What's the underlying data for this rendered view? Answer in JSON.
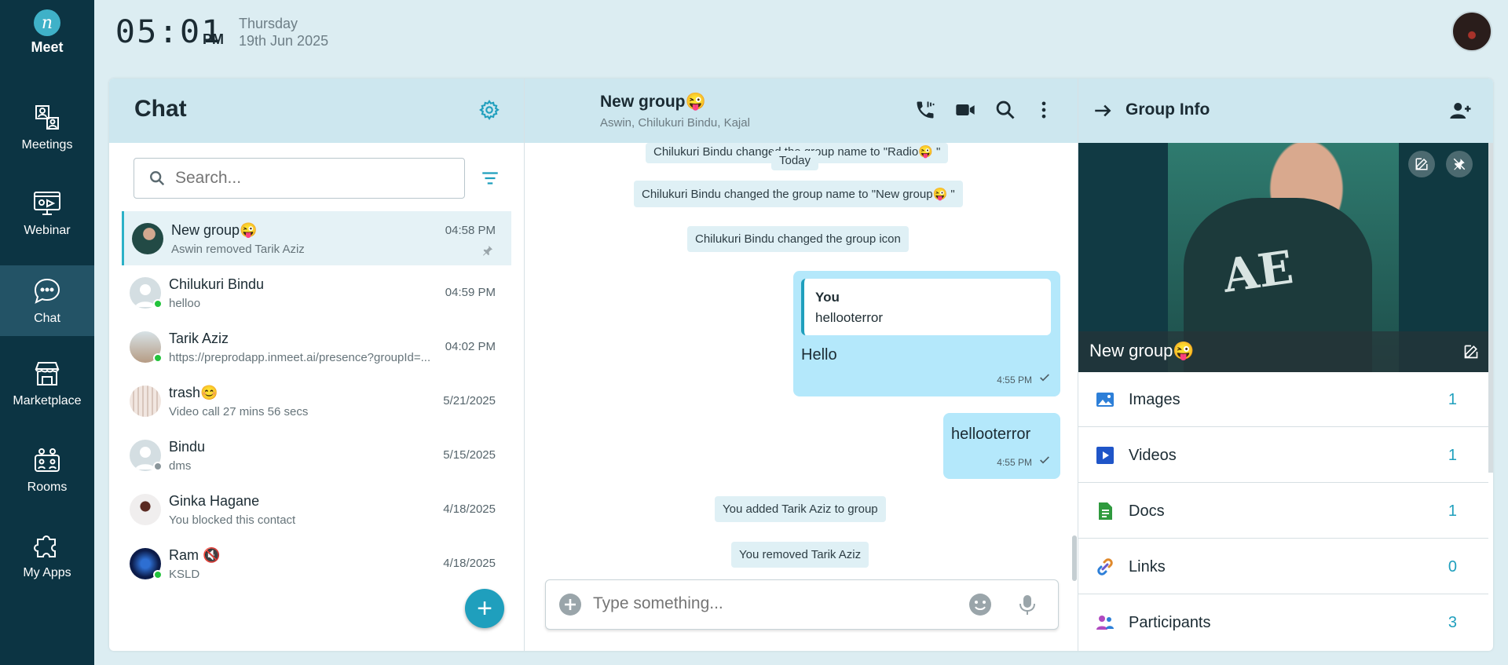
{
  "app": {
    "name": "Meet"
  },
  "nav": {
    "items": [
      {
        "label": "Meetings",
        "icon": "meetings-icon"
      },
      {
        "label": "Webinar",
        "icon": "webinar-icon"
      },
      {
        "label": "Chat",
        "icon": "chat-icon",
        "active": true
      },
      {
        "label": "Marketplace",
        "icon": "marketplace-icon"
      },
      {
        "label": "Rooms",
        "icon": "rooms-icon"
      },
      {
        "label": "My Apps",
        "icon": "my-apps-icon"
      }
    ]
  },
  "topbar": {
    "time": "05:01",
    "ampm": "PM",
    "day": "Thursday",
    "date": "19th Jun 2025"
  },
  "chat_panel": {
    "title": "Chat",
    "search_placeholder": "Search...",
    "items": [
      {
        "name": "New group😜",
        "sub": "Aswin removed Tarik Aziz",
        "time": "04:58 PM",
        "pinned": true,
        "selected": true
      },
      {
        "name": "Chilukuri Bindu",
        "sub": "helloo",
        "time": "04:59 PM",
        "status": "online"
      },
      {
        "name": "Tarik Aziz",
        "sub": "https://preprodapp.inmeet.ai/presence?groupId=...",
        "time": "04:02 PM",
        "status": "online"
      },
      {
        "name": "trash😊",
        "sub": "Video call 27 mins 56 secs",
        "time": "5/21/2025"
      },
      {
        "name": "Bindu",
        "sub": "dms",
        "time": "5/15/2025",
        "status": "away"
      },
      {
        "name": "Ginka Hagane",
        "sub": "You blocked this contact",
        "time": "4/18/2025"
      },
      {
        "name": "Ram 🔇",
        "sub": "KSLD",
        "time": "4/18/2025",
        "status": "online"
      }
    ],
    "fab_label": "+"
  },
  "conversation": {
    "title": "New group😜",
    "members": "Aswin, Chilukuri Bindu, Kajal",
    "sys_partial": "Chilukuri Bindu changed the group name to \"Radio😜 \"",
    "today": "Today",
    "sys1": "Chilukuri Bindu changed the group name to \"New group😜 \"",
    "sys2": "Chilukuri Bindu changed the group icon",
    "msg1": {
      "quote_author": "You",
      "quote_text": "hellooterror",
      "text": "Hello",
      "time": "4:55 PM"
    },
    "msg2": {
      "text": "hellooterror",
      "time": "4:55 PM"
    },
    "sys3": "You added Tarik Aziz to group",
    "sys4": "You removed Tarik Aziz",
    "composer_placeholder": "Type something..."
  },
  "group_info": {
    "title": "Group Info",
    "group_name": "New group😜",
    "media": [
      {
        "label": "Images",
        "count": "1",
        "icon": "images-icon",
        "color": "#2d7fd8"
      },
      {
        "label": "Videos",
        "count": "1",
        "icon": "videos-icon",
        "color": "#1f55c8"
      },
      {
        "label": "Docs",
        "count": "1",
        "icon": "docs-icon",
        "color": "#2f9a3e"
      },
      {
        "label": "Links",
        "count": "0",
        "icon": "links-icon",
        "color": "#6a5acd"
      },
      {
        "label": "Participants",
        "count": "3",
        "icon": "participants-icon",
        "color": "#b04ac0"
      }
    ]
  }
}
